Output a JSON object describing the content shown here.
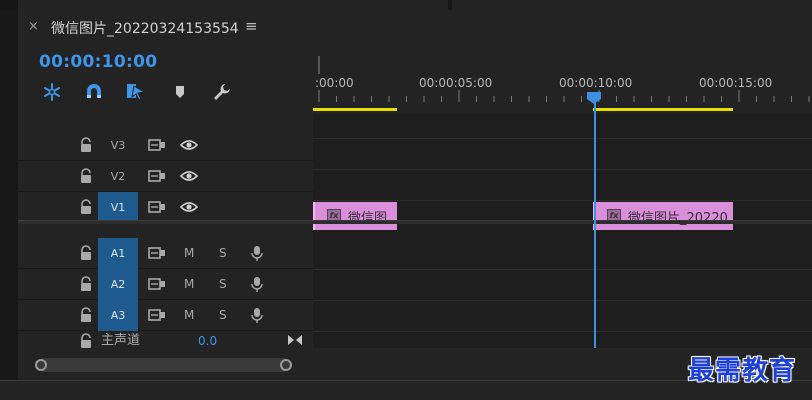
{
  "sequence": {
    "close_glyph": "×",
    "title": "微信图片_20220324153554",
    "menu_glyph": "≡",
    "timecode": "00:00:10:00"
  },
  "tools": [
    {
      "name": "ripple-edit-icon",
      "glyph": "⁕"
    },
    {
      "name": "snap-magnet-icon",
      "glyph": "∩"
    },
    {
      "name": "linked-selection-icon",
      "glyph": "▶"
    },
    {
      "name": "add-marker-icon",
      "glyph": "⬟"
    },
    {
      "name": "wrench-settings-icon",
      "glyph": "🔧"
    }
  ],
  "ruler": {
    "labels": [
      ":00:00",
      "00:00:05:00",
      "00:00:10:00",
      "00:00:15:00"
    ]
  },
  "video_tracks": [
    {
      "name": "V3",
      "active": false
    },
    {
      "name": "V2",
      "active": false
    },
    {
      "name": "V1",
      "active": true
    }
  ],
  "audio_tracks": [
    {
      "name": "A1",
      "mute": "M",
      "solo": "S"
    },
    {
      "name": "A2",
      "mute": "M",
      "solo": "S"
    },
    {
      "name": "A3",
      "mute": "M",
      "solo": "S"
    }
  ],
  "master": {
    "label": "主声道",
    "value": "0.0"
  },
  "clips": [
    {
      "name": "微信图",
      "fx": "fx"
    },
    {
      "name": "微信图片_20220",
      "fx": "fx"
    }
  ],
  "colors": {
    "accent": "#3d96e8",
    "clip": "#d98fd9",
    "work_area": "#e8e000",
    "active_track": "#1f5a8e"
  },
  "watermark": "最需教育"
}
